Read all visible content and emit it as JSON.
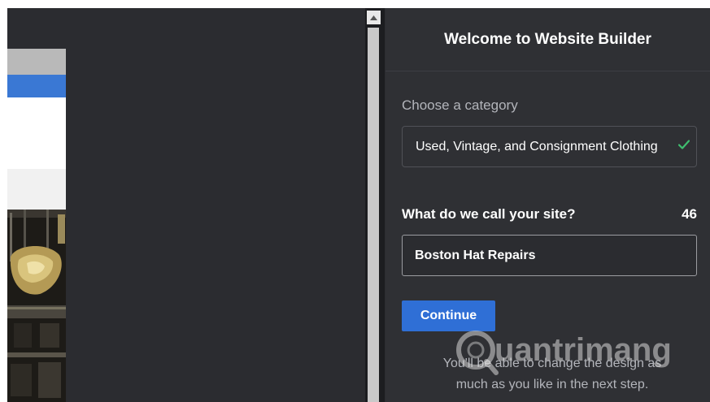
{
  "panel": {
    "title": "Welcome to Website Builder",
    "category_label": "Choose a category",
    "category_value": "Used, Vintage, and Consignment Clothing",
    "site_name_label": "What do we call your site?",
    "site_name_char_count": "46",
    "site_name_value": "Boston Hat Repairs",
    "continue_label": "Continue",
    "hint_line1": "You'll be able to change the design as",
    "hint_line2": "much as you like in the next step."
  },
  "watermark": {
    "text": "uantrimang",
    "icon": "quantrimang-logo-icon"
  },
  "icons": {
    "check": "check-icon",
    "scroll_up": "chevron-up-icon"
  },
  "colors": {
    "panel_bg": "#2f3034",
    "button_blue": "#2f6fd6",
    "check_green": "#3fbf6f",
    "preview_blue_bar": "#3a78d4"
  }
}
